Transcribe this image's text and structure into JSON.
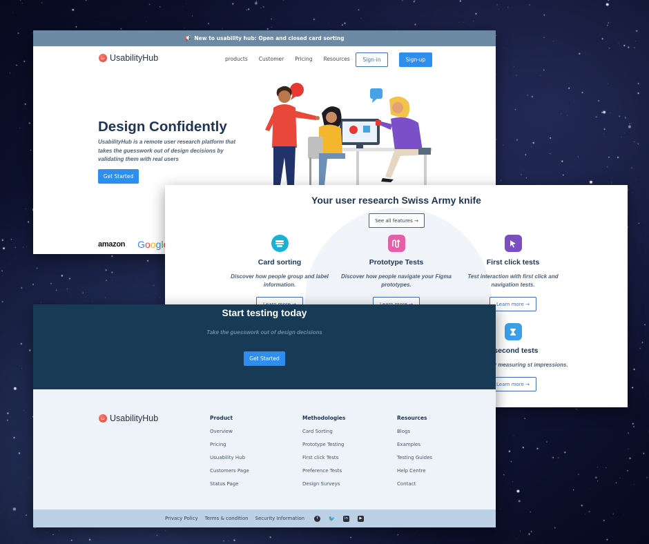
{
  "announcement": {
    "icon": "megaphone-icon",
    "text": "New to usability hub: Open and closed card sorting"
  },
  "brand": {
    "name": "UsabilityHub",
    "logo_icon": "usabilityhub-logo-icon",
    "accent": "#2d8ef0",
    "dark": "#173a56"
  },
  "nav": {
    "links": [
      "products",
      "Customer",
      "Pricing",
      "Resources"
    ],
    "signin": "Sign-in",
    "signup": "Sign-up"
  },
  "hero": {
    "title": "Design Confidently",
    "subtitle": "UsabilityHub is a remote user research platform that takes the guesswork out of design decisions by validating them with real users",
    "cta": "Get Started",
    "illustration": "team-collaboration-illustration"
  },
  "logos": [
    "amazon",
    "Google"
  ],
  "features_section": {
    "title": "Your user research Swiss Army knife",
    "see_all": "See all features →",
    "items": [
      {
        "icon": "card-sorting-icon",
        "color": "#19b1d6",
        "title": "Card sorting",
        "desc": "Discover how people group and label information.",
        "cta": "Learn more →"
      },
      {
        "icon": "prototype-icon",
        "color": "#e55fa7",
        "title": "Prototype Tests",
        "desc": "Discover how people navigate your Figma prototypes.",
        "cta": "Learn more →"
      },
      {
        "icon": "cursor-click-icon",
        "color": "#7b4fc0",
        "title": "First click tests",
        "desc": "Test interaction with first click and navigation tests.",
        "cta": "Learn more →"
      },
      {
        "icon": "hourglass-icon",
        "color": "#3aa0e8",
        "title": "e second tests",
        "desc": "ehensibility by measuring st impressions.",
        "cta": "Learn more →"
      }
    ]
  },
  "cta_band": {
    "title": "Start testing today",
    "subtitle": "Take the guesswork out of design decisions",
    "button": "Get Started"
  },
  "footer": {
    "columns": [
      {
        "heading": "Product",
        "links": [
          "Overview",
          "Pricing",
          "Usuability Hub",
          "Customers Page",
          "Status Page"
        ]
      },
      {
        "heading": "Methodologies",
        "links": [
          "Card Sorting",
          "Prototype Testing",
          "First click Tests",
          "Preference Tests",
          "Design Surveys"
        ]
      },
      {
        "heading": "Resources",
        "links": [
          "Blogs",
          "Examples",
          "Testing Guides",
          "Help Centre",
          "Contact"
        ]
      }
    ],
    "legal": [
      "Privacy Policy",
      "Terms & condition",
      "Security Information"
    ],
    "social_icons": [
      "facebook-icon",
      "twitter-icon",
      "linkedin-icon",
      "youtube-icon"
    ]
  }
}
